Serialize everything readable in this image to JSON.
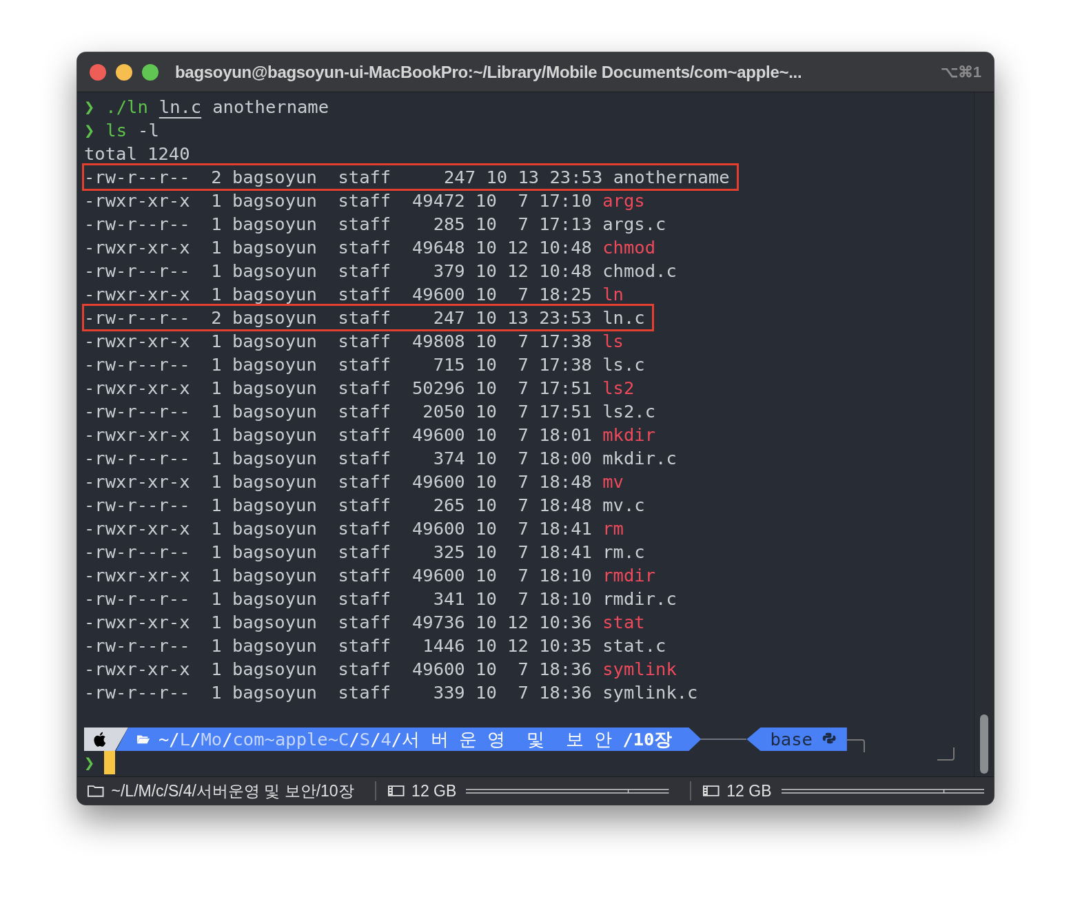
{
  "window": {
    "title": "bagsoyun@bagsoyun-ui-MacBookPro:~/Library/Mobile Documents/com~apple~...",
    "shortcut": "⌥⌘1"
  },
  "commands": [
    {
      "prompt": "❯",
      "tokens": [
        {
          "text": "./ln",
          "kind": "command"
        },
        {
          "text": "ln.c",
          "kind": "path"
        },
        {
          "text": "anothername",
          "kind": "arg"
        }
      ]
    },
    {
      "prompt": "❯",
      "tokens": [
        {
          "text": "ls",
          "kind": "command"
        },
        {
          "text": "-l",
          "kind": "arg"
        }
      ]
    }
  ],
  "total": "total 1240",
  "rows": [
    {
      "line": "-rw-r--r--  2 bagsoyun  staff     247 10 13 23:53",
      "name": "anothername",
      "kind": "file",
      "highlighted": true
    },
    {
      "line": "-rwxr-xr-x  1 bagsoyun  staff  49472 10  7 17:10",
      "name": "args",
      "kind": "exec",
      "highlighted": false
    },
    {
      "line": "-rw-r--r--  1 bagsoyun  staff    285 10  7 17:13",
      "name": "args.c",
      "kind": "file",
      "highlighted": false
    },
    {
      "line": "-rwxr-xr-x  1 bagsoyun  staff  49648 10 12 10:48",
      "name": "chmod",
      "kind": "exec",
      "highlighted": false
    },
    {
      "line": "-rw-r--r--  1 bagsoyun  staff    379 10 12 10:48",
      "name": "chmod.c",
      "kind": "file",
      "highlighted": false
    },
    {
      "line": "-rwxr-xr-x  1 bagsoyun  staff  49600 10  7 18:25",
      "name": "ln",
      "kind": "exec",
      "highlighted": false
    },
    {
      "line": "-rw-r--r--  2 bagsoyun  staff    247 10 13 23:53",
      "name": "ln.c",
      "kind": "file",
      "highlighted": true
    },
    {
      "line": "-rwxr-xr-x  1 bagsoyun  staff  49808 10  7 17:38",
      "name": "ls",
      "kind": "exec",
      "highlighted": false
    },
    {
      "line": "-rw-r--r--  1 bagsoyun  staff    715 10  7 17:38",
      "name": "ls.c",
      "kind": "file",
      "highlighted": false
    },
    {
      "line": "-rwxr-xr-x  1 bagsoyun  staff  50296 10  7 17:51",
      "name": "ls2",
      "kind": "exec",
      "highlighted": false
    },
    {
      "line": "-rw-r--r--  1 bagsoyun  staff   2050 10  7 17:51",
      "name": "ls2.c",
      "kind": "file",
      "highlighted": false
    },
    {
      "line": "-rwxr-xr-x  1 bagsoyun  staff  49600 10  7 18:01",
      "name": "mkdir",
      "kind": "exec",
      "highlighted": false
    },
    {
      "line": "-rw-r--r--  1 bagsoyun  staff    374 10  7 18:00",
      "name": "mkdir.c",
      "kind": "file",
      "highlighted": false
    },
    {
      "line": "-rwxr-xr-x  1 bagsoyun  staff  49600 10  7 18:48",
      "name": "mv",
      "kind": "exec",
      "highlighted": false
    },
    {
      "line": "-rw-r--r--  1 bagsoyun  staff    265 10  7 18:48",
      "name": "mv.c",
      "kind": "file",
      "highlighted": false
    },
    {
      "line": "-rwxr-xr-x  1 bagsoyun  staff  49600 10  7 18:41",
      "name": "rm",
      "kind": "exec",
      "highlighted": false
    },
    {
      "line": "-rw-r--r--  1 bagsoyun  staff    325 10  7 18:41",
      "name": "rm.c",
      "kind": "file",
      "highlighted": false
    },
    {
      "line": "-rwxr-xr-x  1 bagsoyun  staff  49600 10  7 18:10",
      "name": "rmdir",
      "kind": "exec",
      "highlighted": false
    },
    {
      "line": "-rw-r--r--  1 bagsoyun  staff    341 10  7 18:10",
      "name": "rmdir.c",
      "kind": "file",
      "highlighted": false
    },
    {
      "line": "-rwxr-xr-x  1 bagsoyun  staff  49736 10 12 10:36",
      "name": "stat",
      "kind": "exec",
      "highlighted": false
    },
    {
      "line": "-rw-r--r--  1 bagsoyun  staff   1446 10 12 10:35",
      "name": "stat.c",
      "kind": "file",
      "highlighted": false
    },
    {
      "line": "-rwxr-xr-x  1 bagsoyun  staff  49600 10  7 18:36",
      "name": "symlink",
      "kind": "exec",
      "highlighted": false
    },
    {
      "line": "-rw-r--r--  1 bagsoyun  staff    339 10  7 18:36",
      "name": "symlink.c",
      "kind": "file",
      "highlighted": false
    }
  ],
  "powerline": {
    "path": [
      {
        "text": "~/",
        "kind": "normal"
      },
      {
        "text": "L",
        "kind": "dim"
      },
      {
        "text": "/",
        "kind": "normal"
      },
      {
        "text": "Mo",
        "kind": "dim"
      },
      {
        "text": "/",
        "kind": "normal"
      },
      {
        "text": "com~apple~C",
        "kind": "dim"
      },
      {
        "text": "/",
        "kind": "normal"
      },
      {
        "text": "S",
        "kind": "dim"
      },
      {
        "text": "/",
        "kind": "normal"
      },
      {
        "text": "4",
        "kind": "dim"
      },
      {
        "text": "/서 버 운 영  및  보 안 ",
        "kind": "normal"
      },
      {
        "text": "/10장",
        "kind": "bold"
      }
    ],
    "env": "base"
  },
  "prompt": "❯",
  "status_bar": {
    "path": "~/L/M/c/S/4/서버운영 및 보안/10장",
    "disks": [
      "12 GB",
      "12 GB"
    ]
  }
}
